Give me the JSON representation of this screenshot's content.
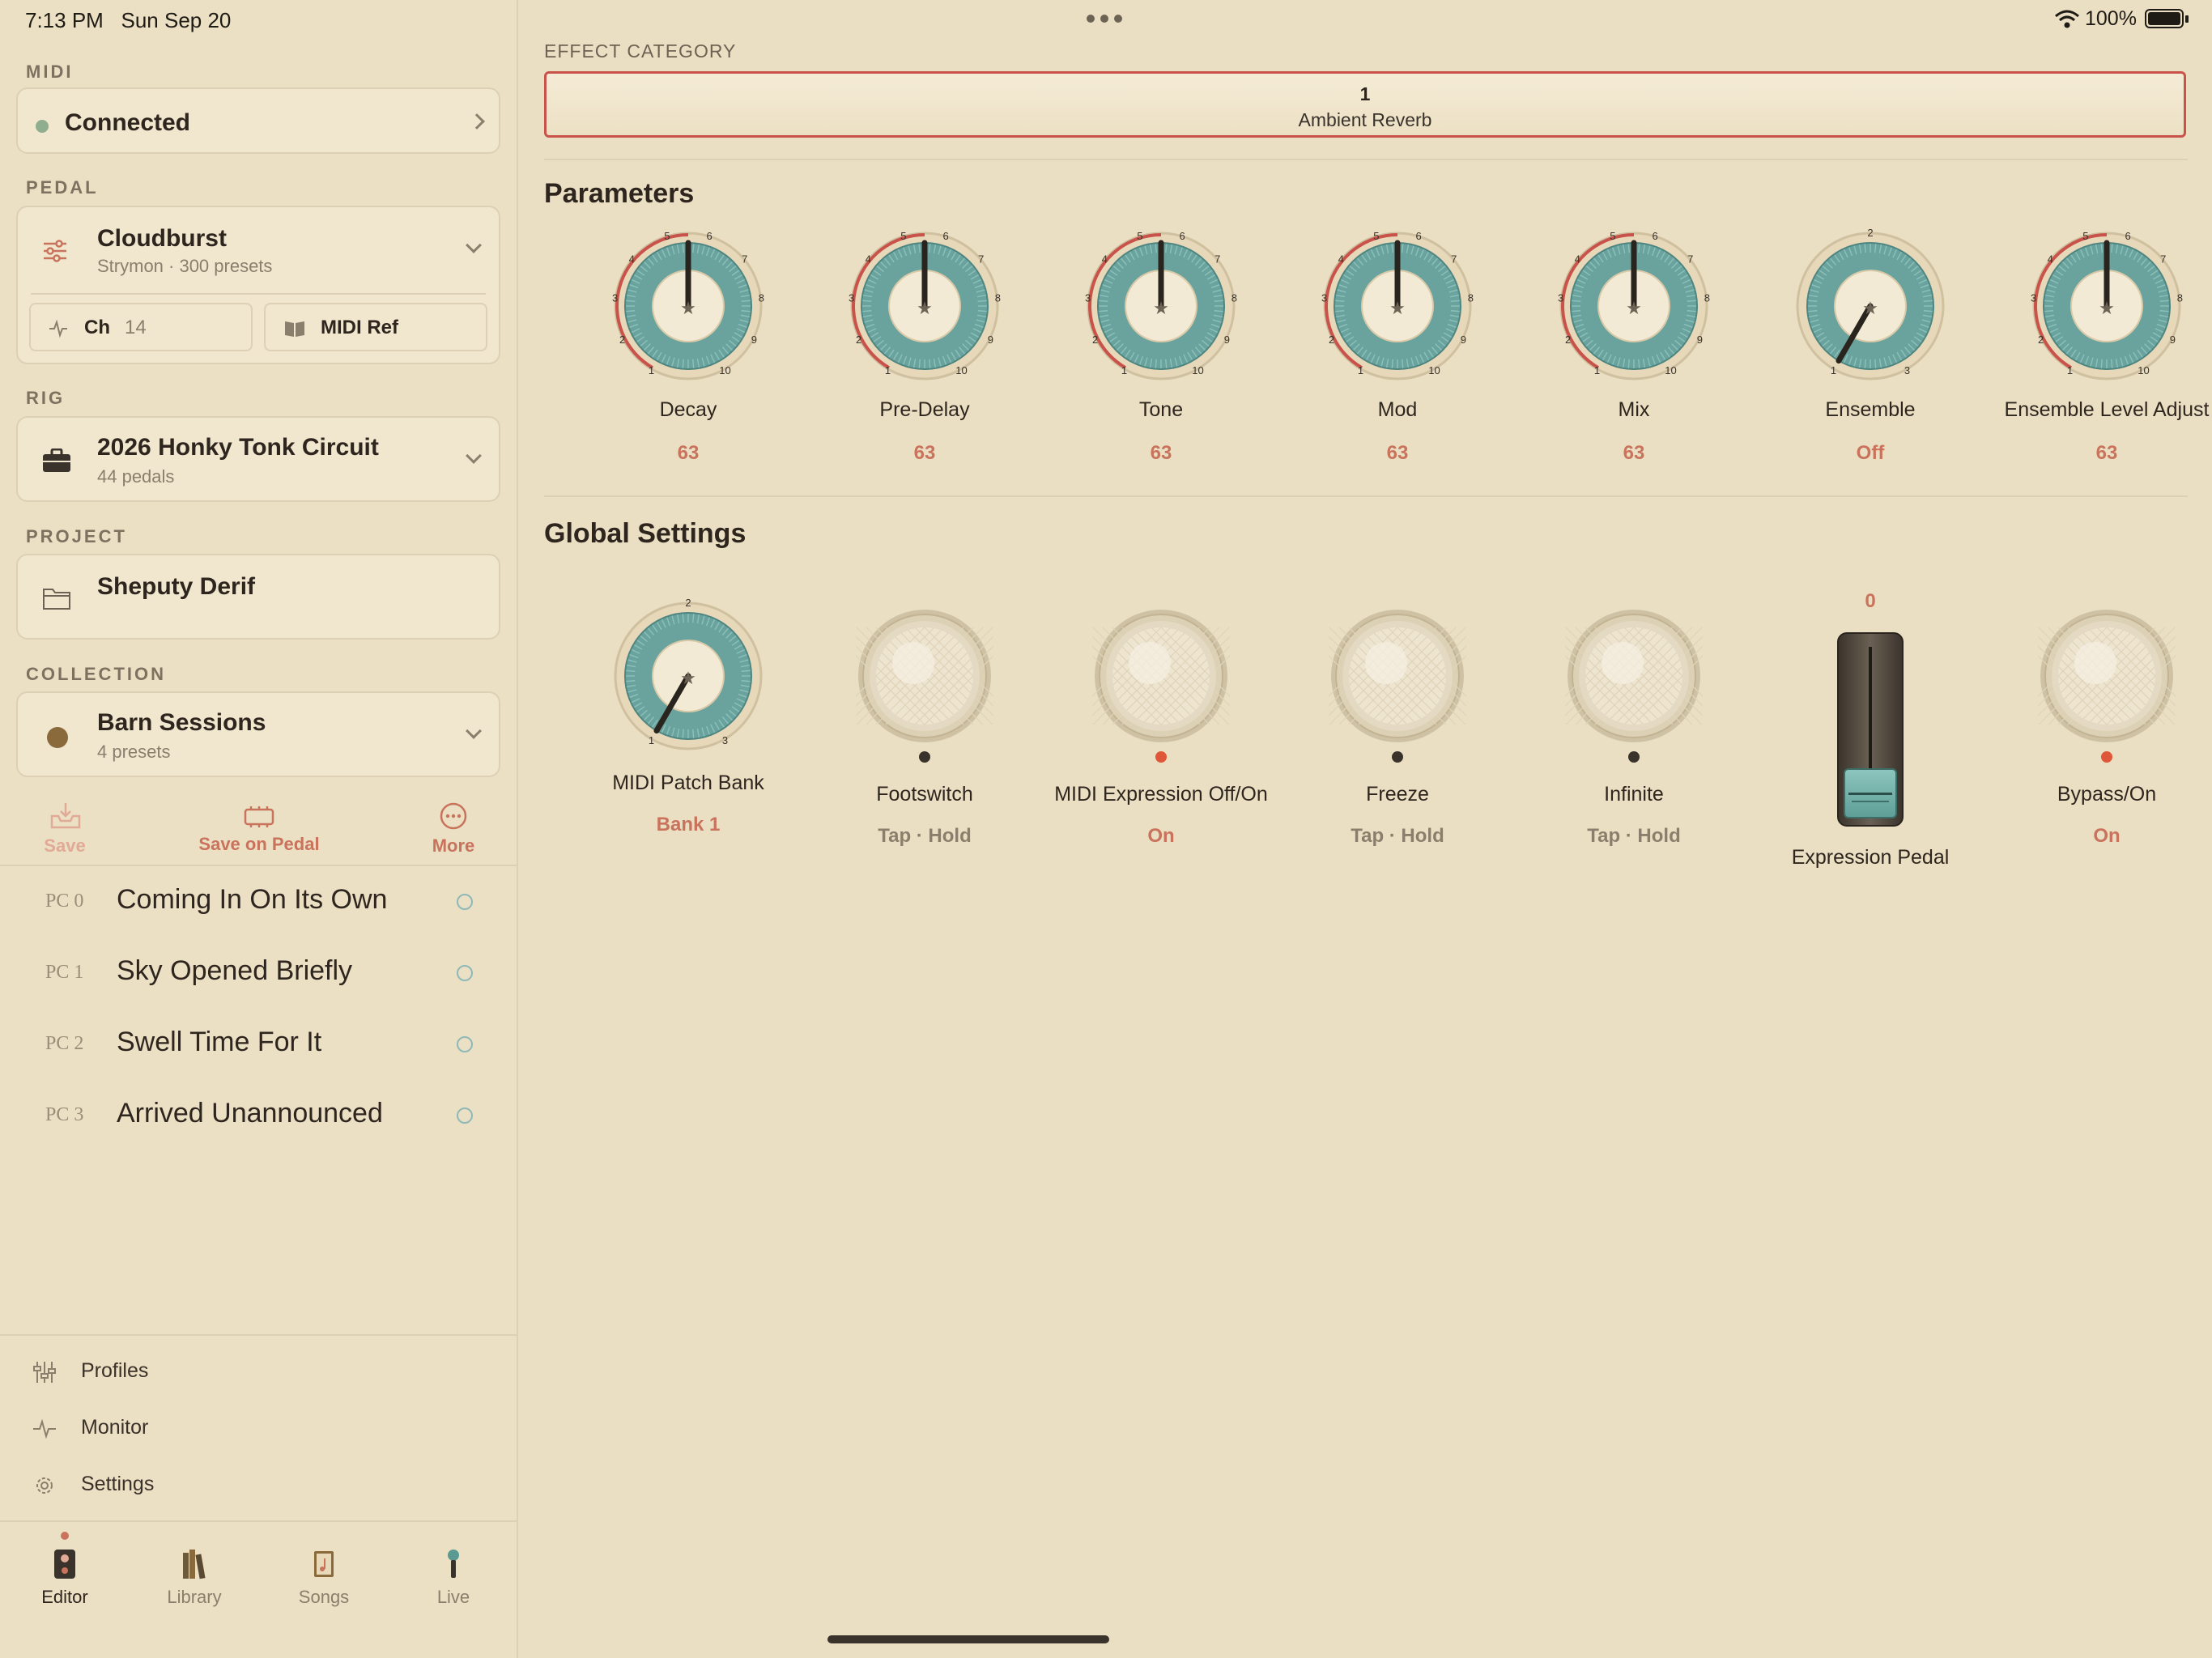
{
  "status_bar": {
    "time": "7:13 PM",
    "date": "Sun Sep 20",
    "battery": "100%"
  },
  "colors": {
    "accent": "#c9735c",
    "teal": "#6aa39e",
    "led_red": "#e05638",
    "led_off": "#3a332b",
    "background": "#ebdfc3"
  },
  "sidebar": {
    "midi": {
      "section_label": "MIDI",
      "status": "Connected"
    },
    "pedal": {
      "section_label": "PEDAL",
      "name": "Cloudburst",
      "subtitle": "Strymon · 300 presets",
      "channel_label": "Ch",
      "channel_value": "14",
      "midi_ref_label": "MIDI Ref"
    },
    "rig": {
      "section_label": "RIG",
      "name": "2026 Honky Tonk Circuit",
      "subtitle": "44 pedals"
    },
    "project": {
      "section_label": "PROJECT",
      "name": "Sheputy Derif"
    },
    "collection": {
      "section_label": "COLLECTION",
      "name": "Barn Sessions",
      "subtitle": "4 presets"
    },
    "actions": {
      "save": "Save",
      "save_on_pedal": "Save on Pedal",
      "more": "More"
    },
    "presets": [
      {
        "pc": "PC 0",
        "name": "Coming In On Its Own"
      },
      {
        "pc": "PC 1",
        "name": "Sky Opened Briefly"
      },
      {
        "pc": "PC 2",
        "name": "Swell Time For It"
      },
      {
        "pc": "PC 3",
        "name": "Arrived Unannounced"
      }
    ],
    "bottom_nav": {
      "profiles": "Profiles",
      "monitor": "Monitor",
      "settings": "Settings"
    },
    "tabs": {
      "editor": "Editor",
      "library": "Library",
      "songs": "Songs",
      "live": "Live"
    }
  },
  "main": {
    "effect_category": {
      "label": "EFFECT CATEGORY",
      "number": "1",
      "name": "Ambient Reverb"
    },
    "parameters": {
      "title": "Parameters",
      "knobs": [
        {
          "name": "Decay",
          "value": "63",
          "level": 0.5,
          "scale": [
            "1",
            "2",
            "3",
            "4",
            "5",
            "6",
            "7",
            "8",
            "9",
            "10"
          ]
        },
        {
          "name": "Pre-Delay",
          "value": "63",
          "level": 0.5,
          "scale": [
            "1",
            "2",
            "3",
            "4",
            "5",
            "6",
            "7",
            "8",
            "9",
            "10"
          ]
        },
        {
          "name": "Tone",
          "value": "63",
          "level": 0.5,
          "scale": [
            "1",
            "2",
            "3",
            "4",
            "5",
            "6",
            "7",
            "8",
            "9",
            "10"
          ]
        },
        {
          "name": "Mod",
          "value": "63",
          "level": 0.5,
          "scale": [
            "1",
            "2",
            "3",
            "4",
            "5",
            "6",
            "7",
            "8",
            "9",
            "10"
          ]
        },
        {
          "name": "Mix",
          "value": "63",
          "level": 0.5,
          "scale": [
            "1",
            "2",
            "3",
            "4",
            "5",
            "6",
            "7",
            "8",
            "9",
            "10"
          ]
        },
        {
          "name": "Ensemble",
          "value": "Off",
          "level": 0.0,
          "scale": [
            "1",
            "2",
            "3"
          ]
        },
        {
          "name": "Ensemble Level Adjust",
          "value": "63",
          "level": 0.5,
          "scale": [
            "1",
            "2",
            "3",
            "4",
            "5",
            "6",
            "7",
            "8",
            "9",
            "10"
          ]
        }
      ]
    },
    "global": {
      "title": "Global Settings",
      "patch_bank": {
        "name": "MIDI Patch Bank",
        "value": "Bank 1",
        "level": 0.0,
        "scale": [
          "1",
          "2",
          "3"
        ]
      },
      "footswitch": {
        "name": "Footswitch",
        "sub": "Tap · Hold",
        "led": "off"
      },
      "midi_expression": {
        "name": "MIDI Expression Off/On",
        "value": "On",
        "led": "on"
      },
      "freeze": {
        "name": "Freeze",
        "sub": "Tap · Hold",
        "led": "off"
      },
      "infinite": {
        "name": "Infinite",
        "sub": "Tap · Hold",
        "led": "off"
      },
      "expression_pedal": {
        "name": "Expression Pedal",
        "value": "0",
        "level": 0.0
      },
      "bypass": {
        "name": "Bypass/On",
        "value": "On",
        "led": "on"
      }
    }
  }
}
